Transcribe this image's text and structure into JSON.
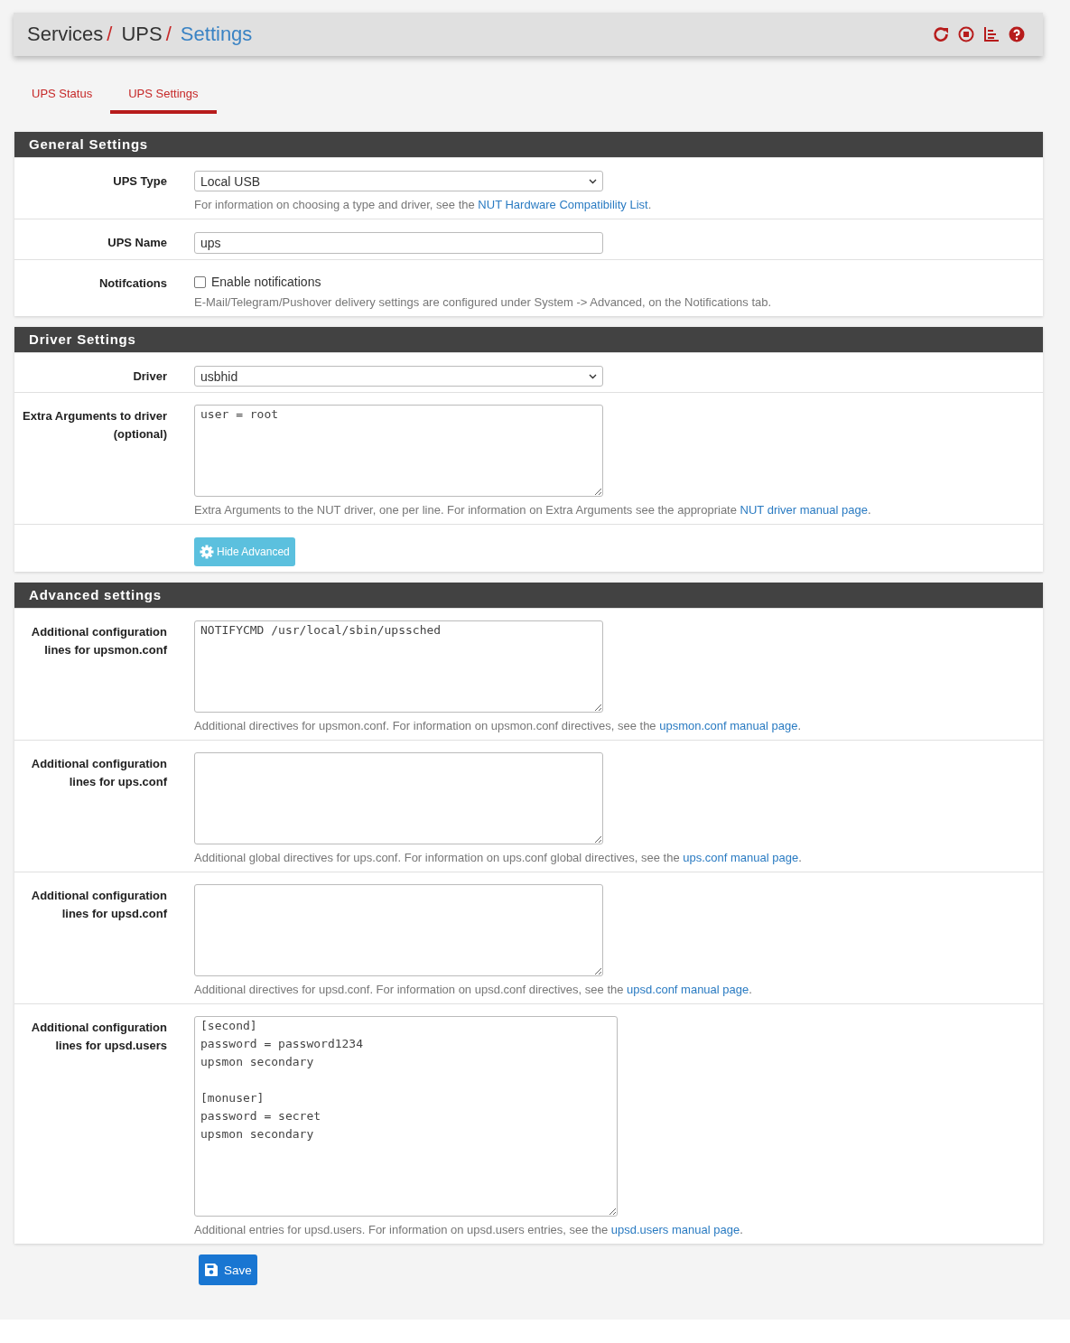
{
  "breadcrumb": [
    {
      "text": "Services",
      "selected": false
    },
    {
      "separator": "/",
      "text": "UPS",
      "selected": false
    },
    {
      "separator": "/",
      "text": "Settings",
      "selected": true
    }
  ],
  "header_icons": [
    {
      "kind": "restart"
    },
    {
      "kind": "stop"
    },
    {
      "kind": "log"
    },
    {
      "kind": "help"
    }
  ],
  "tabs": [
    {
      "label": "UPS Status",
      "selected": false
    },
    {
      "label": "UPS Settings",
      "selected": true
    }
  ],
  "sections": [
    {
      "title": "General Settings",
      "rows": [
        {
          "kind": "select",
          "label": "UPS Type",
          "value": "Local USB",
          "help": {
            "text": "For information on choosing a type and driver, see the ",
            "link": "NUT Hardware Compatibility List",
            "end": "."
          }
        },
        {
          "kind": "input",
          "label": "UPS Name",
          "value": "ups"
        },
        {
          "kind": "checkbox",
          "label": "Notifcations",
          "option": "Enable notifications",
          "checked": false,
          "help": {
            "text": "E-Mail/Telegram/Pushover delivery settings are configured under System -> Advanced, on the Notifications tab."
          }
        }
      ]
    },
    {
      "title": "Driver Settings",
      "rows": [
        {
          "kind": "select",
          "label": "Driver",
          "value": "usbhid"
        },
        {
          "kind": "textarea",
          "label": "Extra Arguments to driver (optional)",
          "value": "user = root",
          "help": {
            "text": "Extra Arguments to the NUT driver, one per line. For information on Extra Arguments see the appropriate ",
            "link": "NUT driver manual page",
            "end": "."
          }
        },
        {
          "kind": "button",
          "label": "Hide Advanced"
        }
      ]
    },
    {
      "title": "Advanced settings",
      "rows": [
        {
          "kind": "textarea",
          "label": "Additional configuration lines for upsmon.conf",
          "value": "NOTIFYCMD /usr/local/sbin/upssched",
          "help": {
            "text": "Additional directives for upsmon.conf. For information on upsmon.conf directives, see the ",
            "link": "upsmon.conf manual page",
            "end": "."
          }
        },
        {
          "kind": "textarea",
          "label": "Additional configuration lines for ups.conf",
          "value": "",
          "help": {
            "text": "Additional global directives for ups.conf. For information on ups.conf global directives, see the ",
            "link": "ups.conf manual page",
            "end": "."
          }
        },
        {
          "kind": "textarea",
          "label": "Additional configuration lines for upsd.conf",
          "value": "",
          "help": {
            "text": "Additional directives for upsd.conf. For information on upsd.conf directives, see the ",
            "link": "upsd.conf manual page",
            "end": "."
          }
        },
        {
          "kind": "textarea",
          "label": "Additional configuration lines for upsd.users",
          "value": "[second]\npassword = password1234\nupsmon secondary\n\n[monuser]\npassword = secret\nupsmon secondary",
          "help": {
            "text": "Additional entries for upsd.users. For information on upsd.users entries, see the ",
            "link": "upsd.users manual page",
            "end": "."
          }
        }
      ]
    }
  ],
  "save_button": "Save"
}
